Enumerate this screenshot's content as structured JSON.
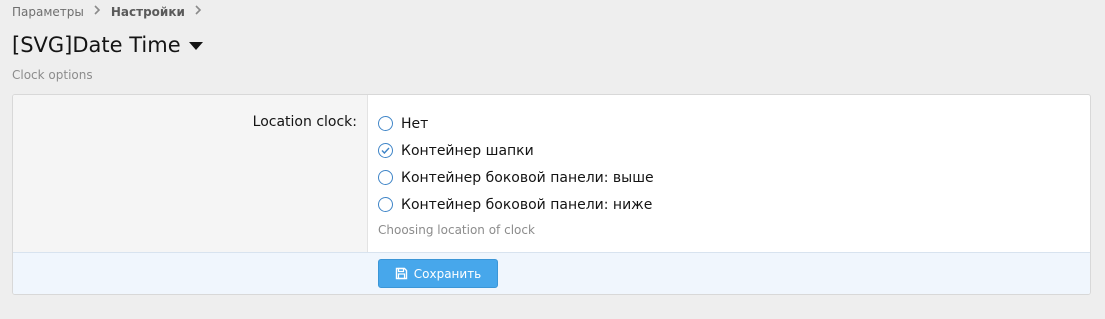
{
  "breadcrumb": {
    "items": [
      {
        "label": "Параметры"
      },
      {
        "label": "Настройки"
      }
    ]
  },
  "header": {
    "title": "[SVG]Date Time",
    "description": "Clock options"
  },
  "form": {
    "field_label": "Location clock:",
    "options": [
      {
        "label": "Нет",
        "checked": false
      },
      {
        "label": "Контейнер шапки",
        "checked": true
      },
      {
        "label": "Контейнер боковой панели: выше",
        "checked": false
      },
      {
        "label": "Контейнер боковой панели: ниже",
        "checked": false
      }
    ],
    "hint": "Choosing location of clock"
  },
  "footer": {
    "save_label": "Сохранить"
  },
  "icons": {
    "breadcrumb_separator": "chevron-right-icon",
    "title_dropdown": "caret-down-icon",
    "radio_checked": "checkmark-icon",
    "save": "floppy-disk-icon"
  },
  "colors": {
    "accent": "#47a7eb",
    "radio_border": "#3e84c7",
    "footer_background": "#f0f6fd",
    "page_background": "#eeeeee"
  }
}
